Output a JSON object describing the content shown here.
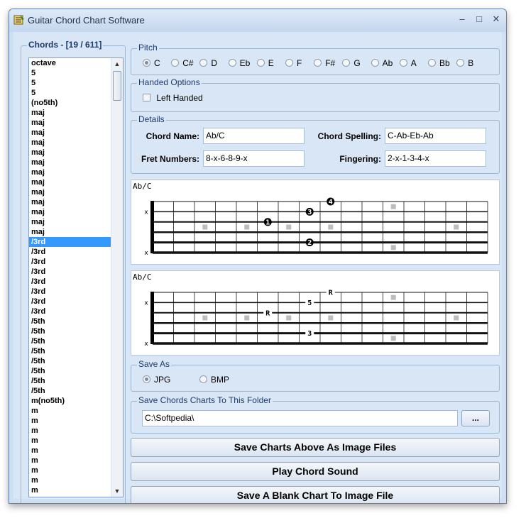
{
  "window": {
    "title": "Guitar Chord Chart Software",
    "minimize_glyph": "–",
    "maximize_glyph": "□",
    "close_glyph": "✕"
  },
  "chords": {
    "label": "Chords - [19 / 611]",
    "items": [
      "octave",
      "5",
      "5",
      "5",
      "(no5th)",
      "maj",
      "maj",
      "maj",
      "maj",
      "maj",
      "maj",
      "maj",
      "maj",
      "maj",
      "maj",
      "maj",
      "maj",
      "maj",
      "/3rd",
      "/3rd",
      "/3rd",
      "/3rd",
      "/3rd",
      "/3rd",
      "/3rd",
      "/3rd",
      "/5th",
      "/5th",
      "/5th",
      "/5th",
      "/5th",
      "/5th",
      "/5th",
      "/5th",
      "m(no5th)",
      "m",
      "m",
      "m",
      "m",
      "m",
      "m",
      "m",
      "m",
      "m",
      "m"
    ],
    "selected_index": 18
  },
  "pitch": {
    "label": "Pitch",
    "options": [
      "C",
      "C#",
      "D",
      "Eb",
      "E",
      "F",
      "F#",
      "G",
      "Ab",
      "A",
      "Bb",
      "B"
    ],
    "selected": "C"
  },
  "handed": {
    "label": "Handed Options",
    "left_handed_label": "Left Handed",
    "left_handed_checked": false
  },
  "details": {
    "label": "Details",
    "chord_name_label": "Chord Name:",
    "chord_name": "Ab/C",
    "chord_spelling_label": "Chord Spelling:",
    "chord_spelling": "C-Ab-Eb-Ab",
    "fret_numbers_label": "Fret Numbers:",
    "fret_numbers": "8-x-6-8-9-x",
    "fingering_label": "Fingering:",
    "fingering": "2-x-1-3-4-x"
  },
  "chart1": {
    "title": "Ab/C",
    "muted_strings": [
      1,
      5
    ],
    "notes": [
      {
        "string": 2,
        "fret": 6,
        "label": "1"
      },
      {
        "string": 4,
        "fret": 8,
        "label": "2"
      },
      {
        "string": 1,
        "fret": 8,
        "label": "3"
      },
      {
        "string": 0,
        "fret": 9,
        "label": "4"
      }
    ]
  },
  "chart2": {
    "title": "Ab/C",
    "muted_strings": [
      1,
      5
    ],
    "notes": [
      {
        "string": 2,
        "fret": 6,
        "label": "R"
      },
      {
        "string": 4,
        "fret": 8,
        "label": "3"
      },
      {
        "string": 1,
        "fret": 8,
        "label": "5"
      },
      {
        "string": 0,
        "fret": 9,
        "label": "R"
      }
    ]
  },
  "save_as": {
    "label": "Save As",
    "options": [
      "JPG",
      "BMP"
    ],
    "selected": "JPG"
  },
  "folder": {
    "label": "Save Chords Charts To This Folder",
    "path": "C:\\Softpedia\\",
    "browse_label": "..."
  },
  "buttons": {
    "save_charts": "Save Charts Above As Image Files",
    "play_sound": "Play Chord Sound",
    "save_blank": "Save A Blank Chart To Image File"
  }
}
